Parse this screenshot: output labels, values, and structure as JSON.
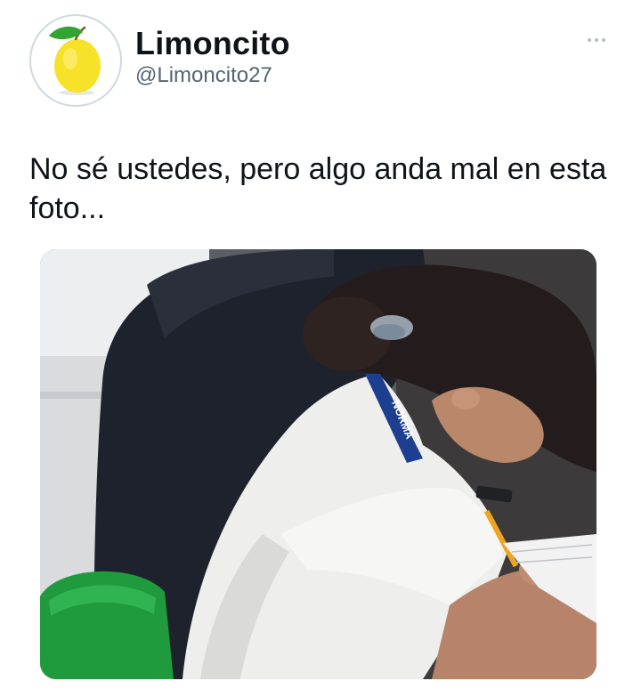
{
  "author": {
    "display_name": "Limoncito",
    "handle": "@Limoncito27",
    "avatar_icon": "lemon-icon"
  },
  "tweet": {
    "text": "No sé ustedes, pero algo anda mal en esta foto..."
  },
  "menu": {
    "icon": "more-options-icon"
  },
  "media": {
    "lanyard_text": "NORMA"
  },
  "colors": {
    "text_primary": "#0f1419",
    "text_secondary": "#536471",
    "lemon_yellow": "#f7e22a",
    "leaf_green": "#33a532"
  }
}
